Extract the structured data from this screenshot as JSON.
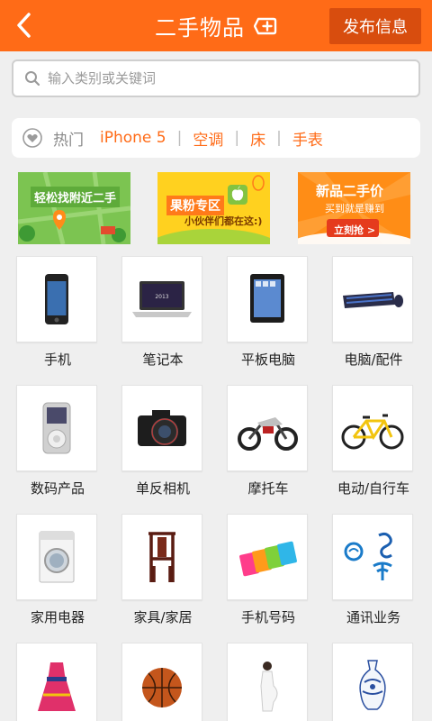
{
  "header": {
    "title": "二手物品",
    "publish_label": "发布信息"
  },
  "search": {
    "placeholder": "输入类别或关键词",
    "value": ""
  },
  "hot": {
    "label": "热门",
    "items": [
      "iPhone 5",
      "空调",
      "床",
      "手表"
    ]
  },
  "banners": [
    {
      "title": "轻松找附近二手",
      "subtitle": ""
    },
    {
      "title": "果粉专区",
      "subtitle": "小伙伴们都在这:)"
    },
    {
      "title": "新品二手价",
      "subtitle": "买到就是赚到",
      "cta": "立刻抢 >"
    }
  ],
  "categories": [
    {
      "label": "手机",
      "icon": "phone-icon"
    },
    {
      "label": "笔记本",
      "icon": "laptop-icon"
    },
    {
      "label": "平板电脑",
      "icon": "tablet-icon"
    },
    {
      "label": "电脑/配件",
      "icon": "keyboard-icon"
    },
    {
      "label": "数码产品",
      "icon": "mp3-player-icon"
    },
    {
      "label": "单反相机",
      "icon": "camera-icon"
    },
    {
      "label": "摩托车",
      "icon": "motorcycle-icon"
    },
    {
      "label": "电动/自行车",
      "icon": "bicycle-icon"
    },
    {
      "label": "家用电器",
      "icon": "washing-machine-icon"
    },
    {
      "label": "家具/家居",
      "icon": "chair-icon"
    },
    {
      "label": "手机号码",
      "icon": "sim-card-icon"
    },
    {
      "label": "通讯业务",
      "icon": "telecom-logo-icon"
    },
    {
      "label": "",
      "icon": "dress-icon"
    },
    {
      "label": "",
      "icon": "basketball-icon"
    },
    {
      "label": "",
      "icon": "maternity-icon"
    },
    {
      "label": "",
      "icon": "vase-icon"
    }
  ],
  "colors": {
    "accent": "#ff6b17",
    "accent_dark": "#d84d0e"
  }
}
